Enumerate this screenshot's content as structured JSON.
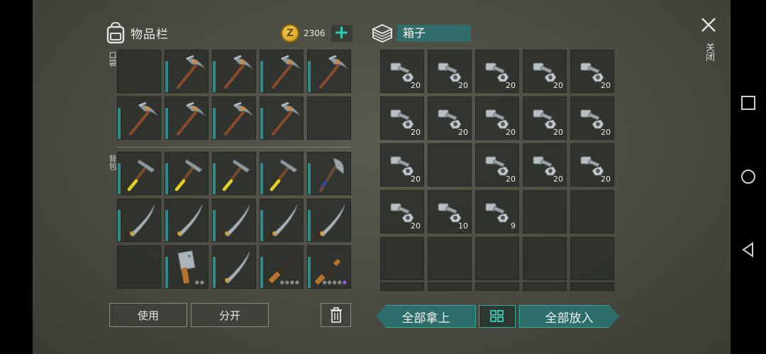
{
  "inventory": {
    "title": "物品栏",
    "money": "2306",
    "pocket_label": "口袋",
    "backpack_label": "背包",
    "pocket_slots": [
      {
        "item": "empty"
      },
      {
        "item": "pickaxe"
      },
      {
        "item": "pickaxe"
      },
      {
        "item": "pickaxe"
      },
      {
        "item": "pickaxe"
      },
      {
        "item": "pickaxe"
      },
      {
        "item": "pickaxe"
      },
      {
        "item": "pickaxe"
      },
      {
        "item": "pickaxe"
      },
      {
        "item": "empty"
      }
    ],
    "backpack_slots": [
      {
        "item": "hammer"
      },
      {
        "item": "hammer"
      },
      {
        "item": "hammer"
      },
      {
        "item": "hammer"
      },
      {
        "item": "axe"
      },
      {
        "item": "machete"
      },
      {
        "item": "machete"
      },
      {
        "item": "machete"
      },
      {
        "item": "machete"
      },
      {
        "item": "machete"
      },
      {
        "item": "empty"
      },
      {
        "item": "cleaver"
      },
      {
        "item": "machete"
      },
      {
        "item": "rifle"
      },
      {
        "item": "ak-rifle"
      }
    ],
    "use_label": "使用",
    "split_label": "分开"
  },
  "box": {
    "title": "箱子",
    "slots": [
      {
        "item": "bolts",
        "qty": "20"
      },
      {
        "item": "bolts",
        "qty": "20"
      },
      {
        "item": "bolts",
        "qty": "20"
      },
      {
        "item": "bolts",
        "qty": "20"
      },
      {
        "item": "bolts",
        "qty": "20"
      },
      {
        "item": "bolts",
        "qty": "20"
      },
      {
        "item": "bolts",
        "qty": "20"
      },
      {
        "item": "bolts",
        "qty": "20"
      },
      {
        "item": "bolts",
        "qty": "20"
      },
      {
        "item": "bolts",
        "qty": "20"
      },
      {
        "item": "bolts",
        "qty": "20"
      },
      {
        "item": "empty"
      },
      {
        "item": "bolts",
        "qty": "20"
      },
      {
        "item": "bolts",
        "qty": "20"
      },
      {
        "item": "bolts",
        "qty": "20"
      },
      {
        "item": "bolts",
        "qty": "20"
      },
      {
        "item": "bolts",
        "qty": "10"
      },
      {
        "item": "bolts",
        "qty": "9"
      },
      {
        "item": "empty"
      },
      {
        "item": "empty"
      },
      {
        "item": "empty"
      },
      {
        "item": "empty"
      },
      {
        "item": "empty"
      },
      {
        "item": "empty"
      },
      {
        "item": "empty"
      }
    ],
    "take_all_label": "全部拿上",
    "put_all_label": "全部放入"
  },
  "close_label": "关闭",
  "colors": {
    "accent": "#2b6d69",
    "plus": "#33c9b3",
    "durability": "#2f8a8a"
  }
}
